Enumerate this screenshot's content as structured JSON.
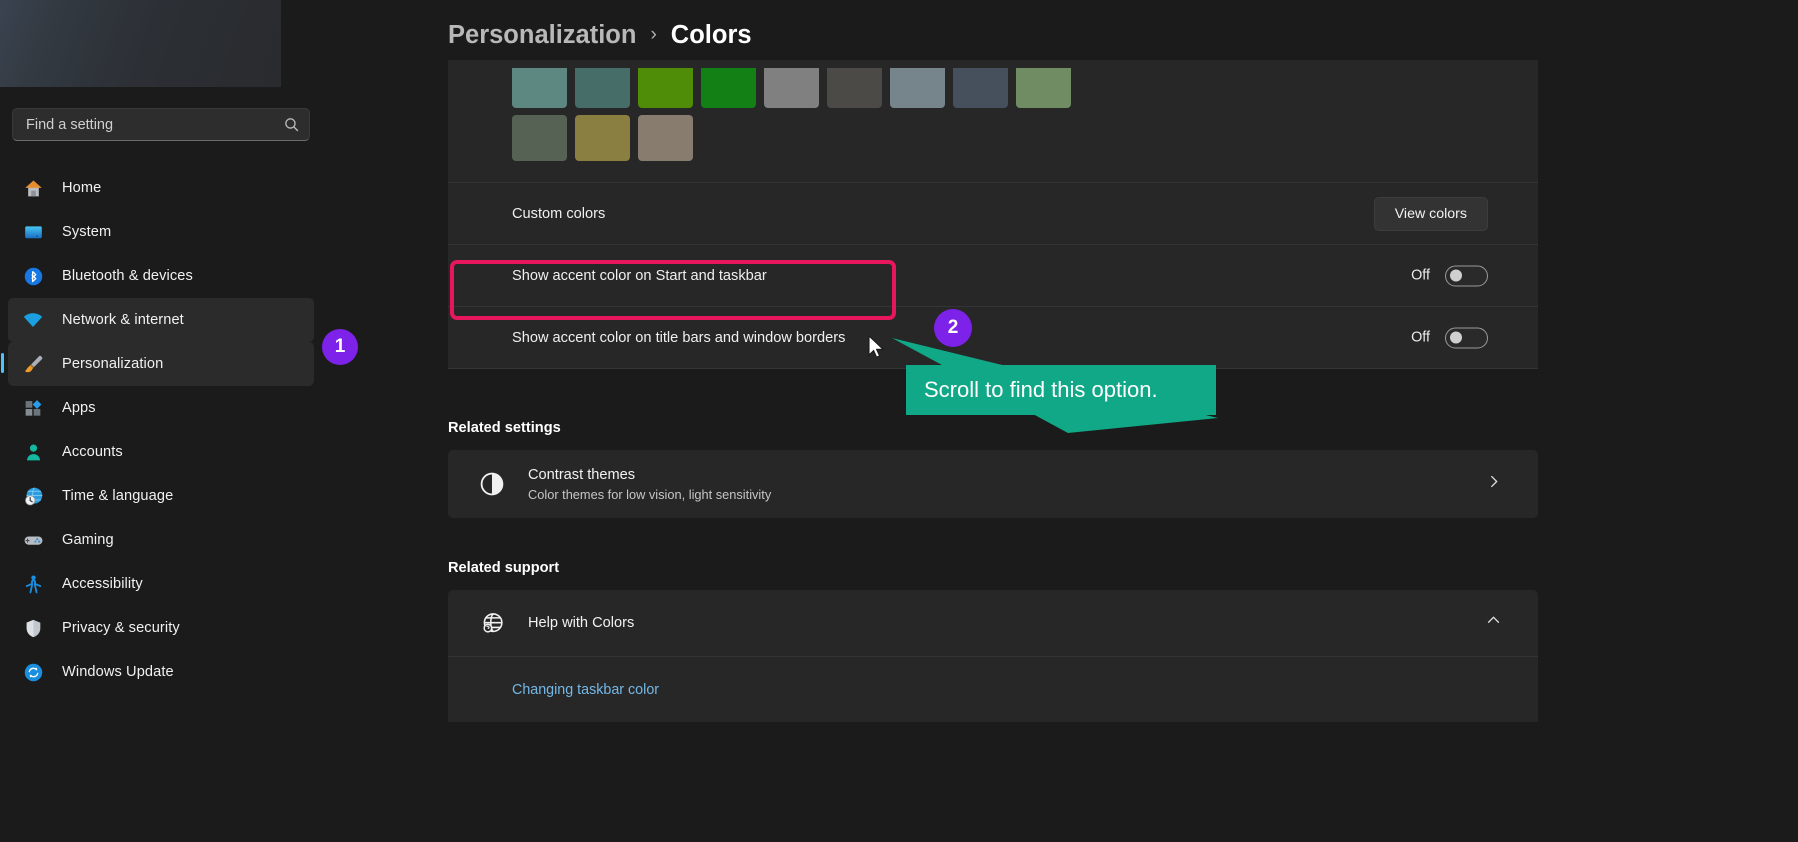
{
  "app": {
    "name": "Windows Settings"
  },
  "search": {
    "placeholder": "Find a setting",
    "value": "",
    "icon": "search-icon"
  },
  "sidebar": {
    "items": [
      {
        "label": "Home",
        "icon": "home-icon",
        "state": "normal"
      },
      {
        "label": "System",
        "icon": "system-icon",
        "state": "normal"
      },
      {
        "label": "Bluetooth & devices",
        "icon": "bluetooth-icon",
        "state": "normal"
      },
      {
        "label": "Network & internet",
        "icon": "wifi-icon",
        "state": "hovered"
      },
      {
        "label": "Personalization",
        "icon": "paintbrush-icon",
        "state": "selected"
      },
      {
        "label": "Apps",
        "icon": "apps-icon",
        "state": "normal"
      },
      {
        "label": "Accounts",
        "icon": "accounts-icon",
        "state": "normal"
      },
      {
        "label": "Time & language",
        "icon": "clock-globe-icon",
        "state": "normal"
      },
      {
        "label": "Gaming",
        "icon": "gamepad-icon",
        "state": "normal"
      },
      {
        "label": "Accessibility",
        "icon": "accessibility-icon",
        "state": "normal"
      },
      {
        "label": "Privacy & security",
        "icon": "shield-icon",
        "state": "normal"
      },
      {
        "label": "Windows Update",
        "icon": "update-icon",
        "state": "normal"
      }
    ]
  },
  "breadcrumb": {
    "parent": "Personalization",
    "separator": "›",
    "current": "Colors"
  },
  "swatches": {
    "row1": [
      "#5d8882",
      "#476d69",
      "#4f8c08",
      "#128015",
      "#808080",
      "#4c4a47",
      "#76858c",
      "#46505c",
      "#6f8c63"
    ],
    "row2": [
      "#566354",
      "#8a7f41",
      "#877c6d"
    ]
  },
  "rows": {
    "custom_colors": {
      "label": "Custom colors",
      "button": "View colors"
    },
    "accent_start_taskbar": {
      "label": "Show accent color on Start and taskbar",
      "state": "Off",
      "on": false
    },
    "accent_title_bars": {
      "label": "Show accent color on title bars and window borders",
      "state": "Off",
      "on": false
    }
  },
  "related_settings": {
    "heading": "Related settings",
    "items": [
      {
        "title": "Contrast themes",
        "subtitle": "Color themes for low vision, light sensitivity",
        "icon": "contrast-icon",
        "chevron": "chevron-right-icon"
      }
    ]
  },
  "related_support": {
    "heading": "Related support",
    "items": [
      {
        "title": "Help with Colors",
        "icon": "globe-help-icon",
        "chevron": "chevron-up-icon"
      }
    ],
    "links": [
      "Changing taskbar color"
    ]
  },
  "annotations": {
    "badge1": "1",
    "badge2": "2",
    "callout_text": "Scroll to find this option.",
    "highlight_color": "#e8175d",
    "badge_color": "#7d22e8",
    "callout_color": "#11a887",
    "cursor": "mouse-pointer-icon"
  }
}
